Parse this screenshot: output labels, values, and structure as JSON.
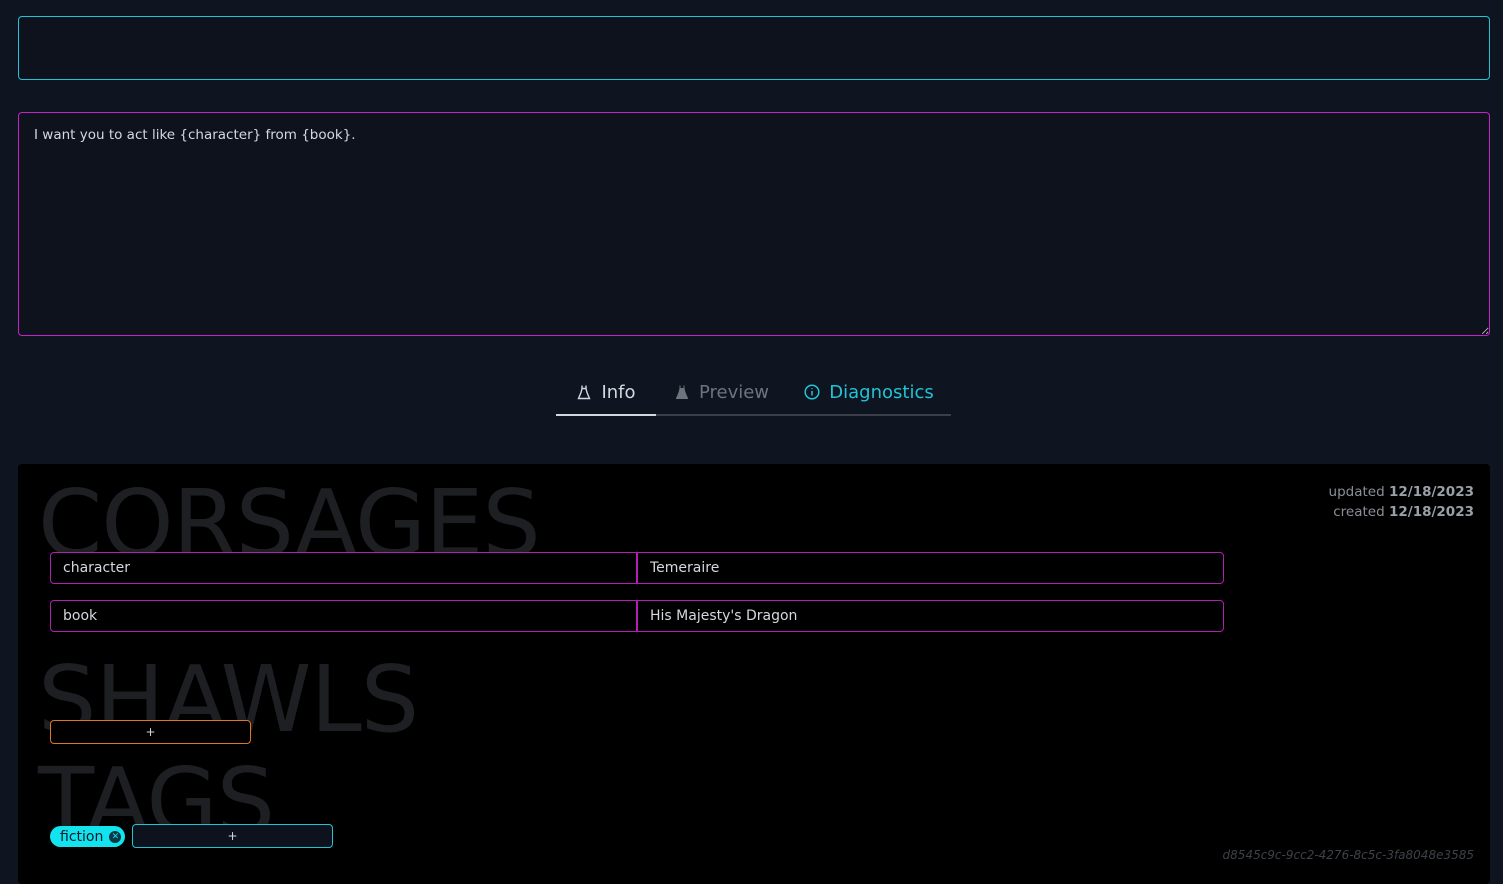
{
  "editor": {
    "title_value": "",
    "prompt_value": "I want you to act like {character} from {book}."
  },
  "tabs": [
    {
      "label": "Info",
      "icon": "dress-icon",
      "state": "active"
    },
    {
      "label": "Preview",
      "icon": "dress-filled-icon",
      "state": "inactive"
    },
    {
      "label": "Diagnostics",
      "icon": "info-circle-icon",
      "state": "highlight"
    }
  ],
  "info": {
    "updated_label": "updated",
    "updated_date": "12/18/2023",
    "created_label": "created",
    "created_date": "12/18/2023",
    "sections": {
      "corsages": "CORSAGES",
      "shawls": "SHAWLS",
      "tags": "TAGS"
    },
    "corsages": [
      {
        "key": "character",
        "value": "Temeraire"
      },
      {
        "key": "book",
        "value": "His Majesty's Dragon"
      }
    ],
    "add_shawl_label": "+",
    "tags": [
      {
        "label": "fiction"
      }
    ],
    "add_tag_label": "+",
    "id": "d8545c9c-9cc2-4276-8c5c-3fa8048e3585"
  },
  "colors": {
    "background": "#0e1420",
    "cyan_accent": "#22c3d6",
    "magenta_accent": "#c81fc8",
    "orange_accent": "#e0761f",
    "tag_chip": "#12e3ee"
  }
}
